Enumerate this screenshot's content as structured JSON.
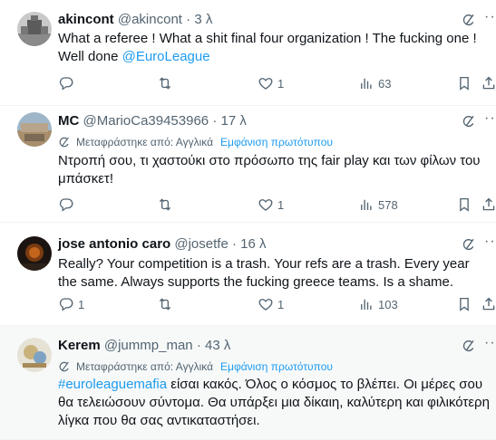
{
  "translation": {
    "label": "Μεταφράστηκε από: Αγγλικά",
    "show_original": "Εμφάνιση πρωτότυπου"
  },
  "tweets": [
    {
      "name": "akincont",
      "handle": "@akincont",
      "dot": "·",
      "time": "3 λ",
      "text": "What a referee  ! What a shit final four organization ! The fucking one ! Well done ",
      "mention": "@EuroLeague",
      "replies": "",
      "retweets": "",
      "likes": "1",
      "views": "63"
    },
    {
      "name": "MC",
      "handle": "@MarioCa39453966",
      "dot": "·",
      "time": "17 λ",
      "text": "Ντροπή σου, τι χαστούκι στο πρόσωπο της fair play και των φίλων του μπάσκετ!",
      "replies": "",
      "retweets": "",
      "likes": "1",
      "views": "578"
    },
    {
      "name": "jose antonio caro",
      "handle": "@josetfe",
      "dot": "·",
      "time": "16 λ",
      "text": "Really? Your competition is a trash. Your refs are a trash. Every year the same. Always supports the fucking greece teams. Is a shame.",
      "replies": "1",
      "retweets": "",
      "likes": "1",
      "views": "103"
    },
    {
      "name": "Kerem",
      "handle": "@jummp_man",
      "dot": "·",
      "time": "43 λ",
      "hashtag": "#euroleaguemafia",
      "text": " είσαι κακός. Όλος ο κόσμος το βλέπει. Οι μέρες σου θα τελειώσουν σύντομα. Θα υπάρξει μια δίκαιη, καλύτερη και φιλικότερη λίγκα που θα σας αντικαταστήσει."
    }
  ],
  "colors": {
    "accent": "#1d9bf0",
    "secondary_text": "#536471",
    "highlight_bg": "#f7f9f9"
  }
}
